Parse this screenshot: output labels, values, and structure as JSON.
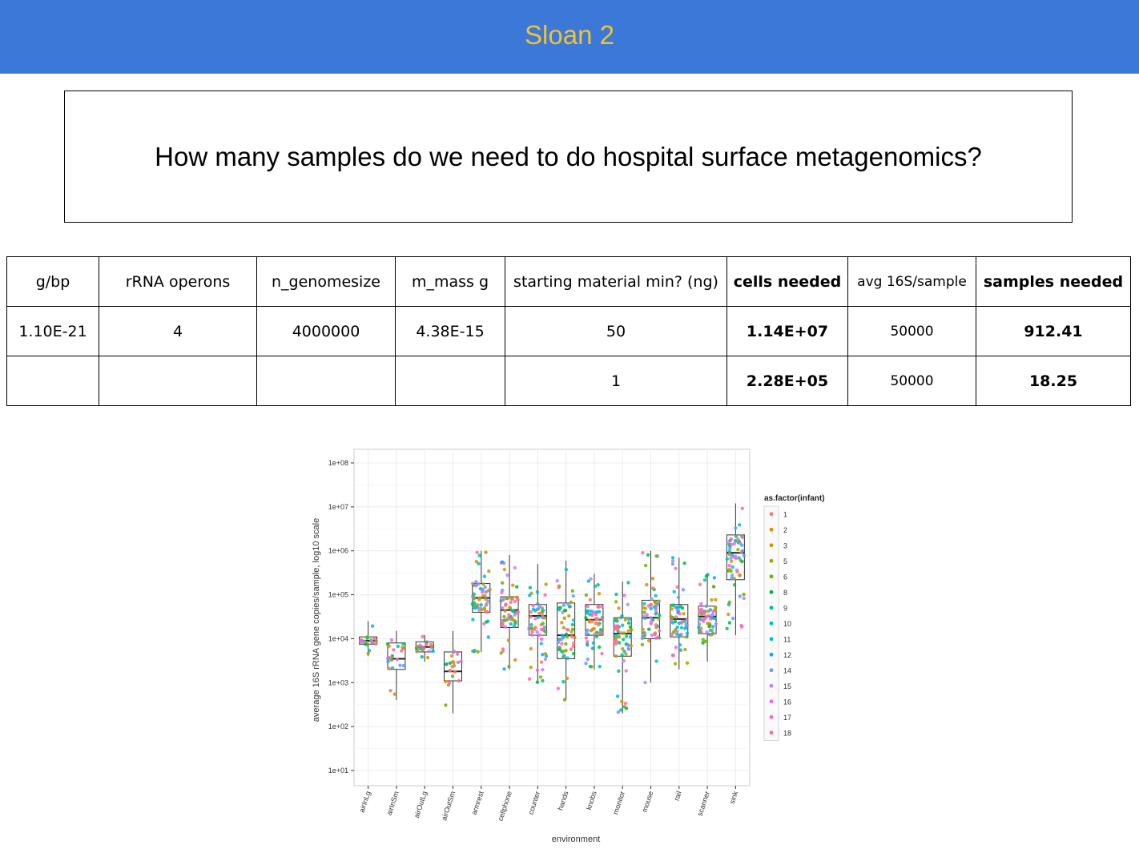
{
  "banner": {
    "title": "Sloan 2"
  },
  "question": {
    "text": "How many samples do we need to do hospital surface metagenomics?"
  },
  "table": {
    "headers": [
      "g/bp",
      "rRNA operons",
      "n_genomesize",
      "m_mass g",
      "starting material min? (ng)",
      "cells needed",
      "avg 16S/sample",
      "samples needed"
    ],
    "rows": [
      [
        "1.10E-21",
        "4",
        "4000000",
        "4.38E-15",
        "50",
        "1.14E+07",
        "50000",
        "912.41"
      ],
      [
        "",
        "",
        "",
        "",
        "1",
        "2.28E+05",
        "50000",
        "18.25"
      ]
    ]
  },
  "chart_data": {
    "type": "boxplot",
    "xlabel": "environment",
    "ylabel": "average 16S rRNA gene copies/sample, log10 scale",
    "y_scale": "log10",
    "ylim": [
      10,
      100000000
    ],
    "y_ticks": [
      "1e+01",
      "1e+02",
      "1e+03",
      "1e+04",
      "1e+05",
      "1e+06",
      "1e+07",
      "1e+08"
    ],
    "grid": true,
    "legend": {
      "title": "as.factor(infant)",
      "placement": "right",
      "entries": [
        "1",
        "2",
        "3",
        "5",
        "6",
        "8",
        "9",
        "10",
        "11",
        "12",
        "14",
        "15",
        "16",
        "17",
        "18"
      ],
      "colors": [
        "#f8766d",
        "#e58700",
        "#c99800",
        "#a3a500",
        "#6bb100",
        "#00ba38",
        "#00bf7d",
        "#00c0af",
        "#00bcd8",
        "#00b0f6",
        "#619cff",
        "#b983ff",
        "#e76bf3",
        "#fd61d1",
        "#ff67a4"
      ]
    },
    "categories": [
      "airInLg",
      "airInSm",
      "airOutLg",
      "airOutSm",
      "armrest",
      "cellphone",
      "counter",
      "hands",
      "knobs",
      "monitor",
      "mouse",
      "rail",
      "scanner",
      "sink"
    ],
    "boxes": [
      {
        "q1": 7500,
        "median": 9000,
        "q3": 11000,
        "whisker_low": 4000,
        "whisker_high": 25000
      },
      {
        "q1": 2000,
        "median": 3500,
        "q3": 8000,
        "whisker_low": 400,
        "whisker_high": 15000
      },
      {
        "q1": 5000,
        "median": 6500,
        "q3": 8500,
        "whisker_low": 3000,
        "whisker_high": 12000
      },
      {
        "q1": 1100,
        "median": 1800,
        "q3": 5000,
        "whisker_low": 200,
        "whisker_high": 15000
      },
      {
        "q1": 40000,
        "median": 85000,
        "q3": 180000,
        "whisker_low": 5000,
        "whisker_high": 1000000
      },
      {
        "q1": 18000,
        "median": 45000,
        "q3": 90000,
        "whisker_low": 2000,
        "whisker_high": 800000
      },
      {
        "q1": 12000,
        "median": 33000,
        "q3": 60000,
        "whisker_low": 1000,
        "whisker_high": 500000
      },
      {
        "q1": 3500,
        "median": 12000,
        "q3": 65000,
        "whisker_low": 400,
        "whisker_high": 600000
      },
      {
        "q1": 12000,
        "median": 27000,
        "q3": 60000,
        "whisker_low": 2000,
        "whisker_high": 300000
      },
      {
        "q1": 4000,
        "median": 13000,
        "q3": 30000,
        "whisker_low": 200,
        "whisker_high": 200000
      },
      {
        "q1": 10000,
        "median": 30000,
        "q3": 75000,
        "whisker_low": 1000,
        "whisker_high": 1000000
      },
      {
        "q1": 11000,
        "median": 28000,
        "q3": 60000,
        "whisker_low": 2000,
        "whisker_high": 700000
      },
      {
        "q1": 13000,
        "median": 32000,
        "q3": 55000,
        "whisker_low": 3000,
        "whisker_high": 300000
      },
      {
        "q1": 220000,
        "median": 900000,
        "q3": 2300000,
        "whisker_low": 12000,
        "whisker_high": 12000000
      }
    ]
  }
}
